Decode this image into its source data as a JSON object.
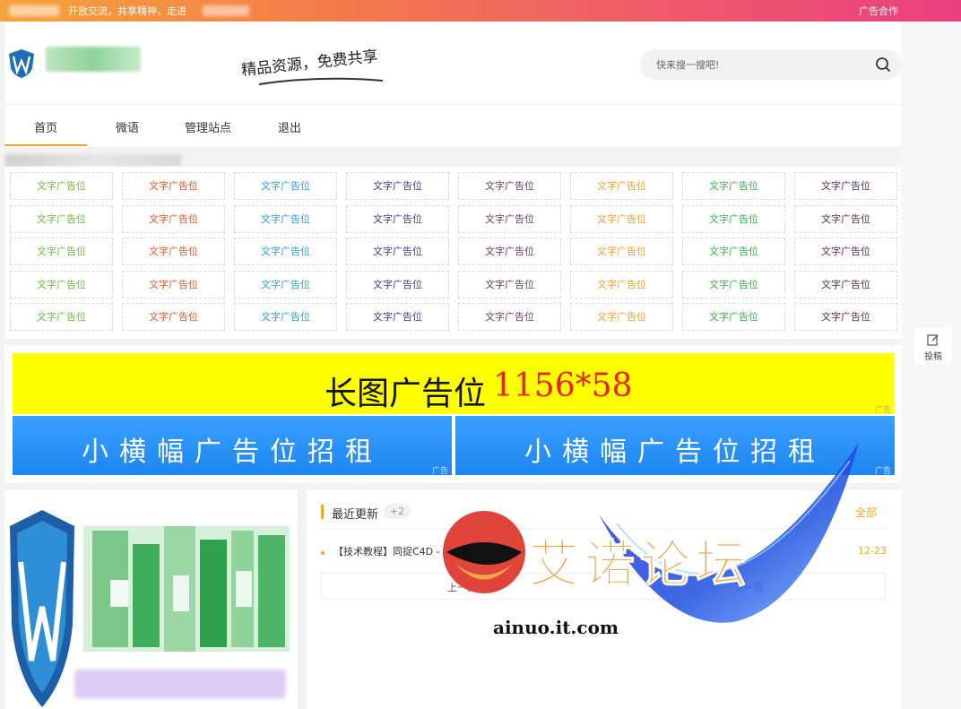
{
  "topbar": {
    "welcome": "开放交流，共享精神，走进",
    "ad_link": "广告合作"
  },
  "header": {
    "slogan": "精品资源，免费共享"
  },
  "search": {
    "placeholder": "快来搜一搜吧!"
  },
  "nav": {
    "items": [
      "首页",
      "微语",
      "管理站点",
      "退出"
    ],
    "active_index": 0,
    "active_color": "#f5a623"
  },
  "text_ads": {
    "label": "文字广告位",
    "column_colors": [
      "#6bbf3a",
      "#e8562a",
      "#2a9fd6",
      "#3a3a8c",
      "#6a3a6a",
      "#f0a030",
      "#35b34a",
      "#5a2a5a"
    ],
    "rows": 5
  },
  "banners": {
    "long_text": "长图广告位",
    "long_size": "1156*58",
    "half_text": "小横幅广告位招租",
    "ad_tag": "广告"
  },
  "recent": {
    "title": "最近更新",
    "badge": "+2",
    "all_link": "全部",
    "item": "【技术教程】同捉C4D - PS潮流海报系列课",
    "date": "12-23",
    "prev": "上一页",
    "next": "下一页"
  },
  "sidebar": {
    "submit": "投稿"
  },
  "watermark": {
    "text": "艾诺论坛",
    "url": "ainuo.it.com"
  }
}
